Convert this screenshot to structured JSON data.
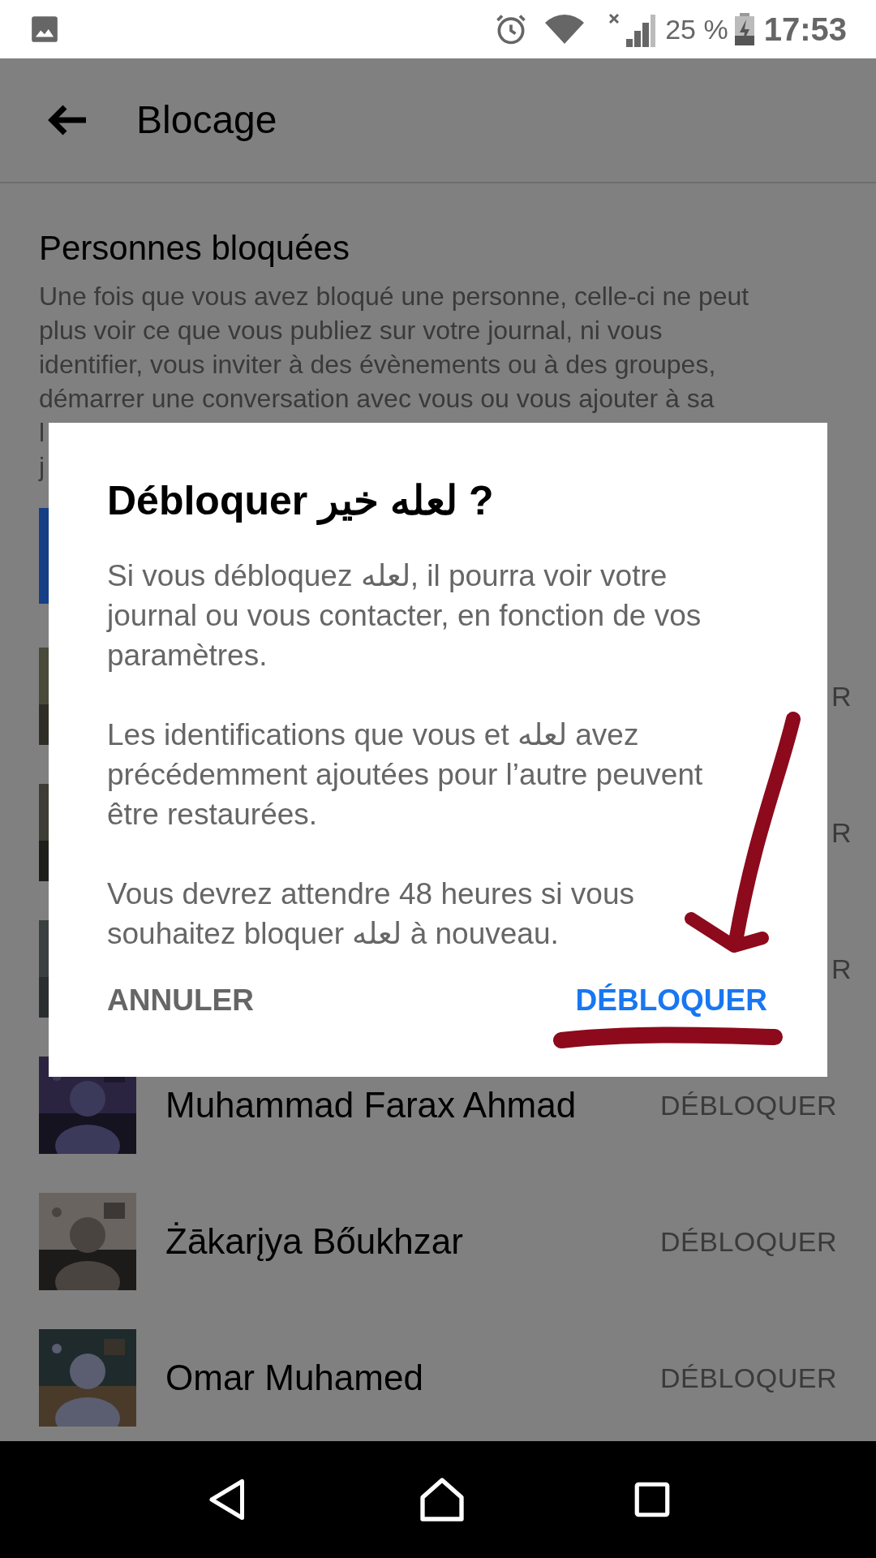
{
  "status_bar": {
    "battery": "25 %",
    "time": "17:53"
  },
  "app_bar": {
    "title": "Blocage"
  },
  "section": {
    "title": "Personnes bloquées",
    "lines": [
      "Une fois que vous avez bloqué une personne, celle-ci ne peut",
      "plus voir ce que vous publiez sur votre journal, ni vous",
      "identifier, vous inviter à des évènements ou à des groupes,",
      "démarrer une conversation avec vous ou vous ajouter à sa",
      "l",
      "j"
    ]
  },
  "blocked_list": [
    {
      "kind": "covered",
      "button": "R"
    },
    {
      "kind": "covered",
      "button": "R"
    },
    {
      "kind": "covered",
      "button": "R"
    },
    {
      "kind": "full",
      "name": "Muhammad Farax Ahmad",
      "button": "DÉBLOQUER"
    },
    {
      "kind": "full",
      "name": "Żākarįya Bőukhzar",
      "button": "DÉBLOQUER"
    },
    {
      "kind": "full",
      "name": "Omar Muhamed",
      "button": "DÉBLOQUER"
    }
  ],
  "dialog": {
    "title": "Débloquer لعله خير ?",
    "paragraphs": [
      "Si vous débloquez لعله, il pourra voir votre journal ou vous contacter, en fonction de vos paramètres.",
      "Les identifications que vous et لعله avez précédemment ajoutées pour l’autre peuvent être restaurées.",
      "Vous devrez attendre 48 heures si vous souhaitez bloquer لعله à nouveau."
    ],
    "cancel_button": "ANNULER",
    "confirm_button": "DÉBLOQUER"
  }
}
